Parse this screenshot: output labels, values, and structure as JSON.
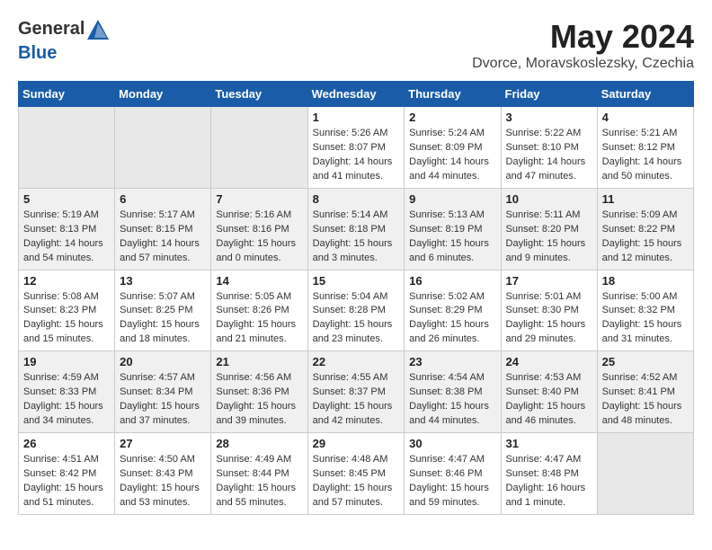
{
  "header": {
    "logo": {
      "general": "General",
      "blue": "Blue",
      "tagline": ""
    },
    "title": "May 2024",
    "location": "Dvorce, Moravskoslezsky, Czechia"
  },
  "calendar": {
    "days_of_week": [
      "Sunday",
      "Monday",
      "Tuesday",
      "Wednesday",
      "Thursday",
      "Friday",
      "Saturday"
    ],
    "weeks": [
      [
        {
          "day": "",
          "info": ""
        },
        {
          "day": "",
          "info": ""
        },
        {
          "day": "",
          "info": ""
        },
        {
          "day": "1",
          "info": "Sunrise: 5:26 AM\nSunset: 8:07 PM\nDaylight: 14 hours\nand 41 minutes."
        },
        {
          "day": "2",
          "info": "Sunrise: 5:24 AM\nSunset: 8:09 PM\nDaylight: 14 hours\nand 44 minutes."
        },
        {
          "day": "3",
          "info": "Sunrise: 5:22 AM\nSunset: 8:10 PM\nDaylight: 14 hours\nand 47 minutes."
        },
        {
          "day": "4",
          "info": "Sunrise: 5:21 AM\nSunset: 8:12 PM\nDaylight: 14 hours\nand 50 minutes."
        }
      ],
      [
        {
          "day": "5",
          "info": "Sunrise: 5:19 AM\nSunset: 8:13 PM\nDaylight: 14 hours\nand 54 minutes."
        },
        {
          "day": "6",
          "info": "Sunrise: 5:17 AM\nSunset: 8:15 PM\nDaylight: 14 hours\nand 57 minutes."
        },
        {
          "day": "7",
          "info": "Sunrise: 5:16 AM\nSunset: 8:16 PM\nDaylight: 15 hours\nand 0 minutes."
        },
        {
          "day": "8",
          "info": "Sunrise: 5:14 AM\nSunset: 8:18 PM\nDaylight: 15 hours\nand 3 minutes."
        },
        {
          "day": "9",
          "info": "Sunrise: 5:13 AM\nSunset: 8:19 PM\nDaylight: 15 hours\nand 6 minutes."
        },
        {
          "day": "10",
          "info": "Sunrise: 5:11 AM\nSunset: 8:20 PM\nDaylight: 15 hours\nand 9 minutes."
        },
        {
          "day": "11",
          "info": "Sunrise: 5:09 AM\nSunset: 8:22 PM\nDaylight: 15 hours\nand 12 minutes."
        }
      ],
      [
        {
          "day": "12",
          "info": "Sunrise: 5:08 AM\nSunset: 8:23 PM\nDaylight: 15 hours\nand 15 minutes."
        },
        {
          "day": "13",
          "info": "Sunrise: 5:07 AM\nSunset: 8:25 PM\nDaylight: 15 hours\nand 18 minutes."
        },
        {
          "day": "14",
          "info": "Sunrise: 5:05 AM\nSunset: 8:26 PM\nDaylight: 15 hours\nand 21 minutes."
        },
        {
          "day": "15",
          "info": "Sunrise: 5:04 AM\nSunset: 8:28 PM\nDaylight: 15 hours\nand 23 minutes."
        },
        {
          "day": "16",
          "info": "Sunrise: 5:02 AM\nSunset: 8:29 PM\nDaylight: 15 hours\nand 26 minutes."
        },
        {
          "day": "17",
          "info": "Sunrise: 5:01 AM\nSunset: 8:30 PM\nDaylight: 15 hours\nand 29 minutes."
        },
        {
          "day": "18",
          "info": "Sunrise: 5:00 AM\nSunset: 8:32 PM\nDaylight: 15 hours\nand 31 minutes."
        }
      ],
      [
        {
          "day": "19",
          "info": "Sunrise: 4:59 AM\nSunset: 8:33 PM\nDaylight: 15 hours\nand 34 minutes."
        },
        {
          "day": "20",
          "info": "Sunrise: 4:57 AM\nSunset: 8:34 PM\nDaylight: 15 hours\nand 37 minutes."
        },
        {
          "day": "21",
          "info": "Sunrise: 4:56 AM\nSunset: 8:36 PM\nDaylight: 15 hours\nand 39 minutes."
        },
        {
          "day": "22",
          "info": "Sunrise: 4:55 AM\nSunset: 8:37 PM\nDaylight: 15 hours\nand 42 minutes."
        },
        {
          "day": "23",
          "info": "Sunrise: 4:54 AM\nSunset: 8:38 PM\nDaylight: 15 hours\nand 44 minutes."
        },
        {
          "day": "24",
          "info": "Sunrise: 4:53 AM\nSunset: 8:40 PM\nDaylight: 15 hours\nand 46 minutes."
        },
        {
          "day": "25",
          "info": "Sunrise: 4:52 AM\nSunset: 8:41 PM\nDaylight: 15 hours\nand 48 minutes."
        }
      ],
      [
        {
          "day": "26",
          "info": "Sunrise: 4:51 AM\nSunset: 8:42 PM\nDaylight: 15 hours\nand 51 minutes."
        },
        {
          "day": "27",
          "info": "Sunrise: 4:50 AM\nSunset: 8:43 PM\nDaylight: 15 hours\nand 53 minutes."
        },
        {
          "day": "28",
          "info": "Sunrise: 4:49 AM\nSunset: 8:44 PM\nDaylight: 15 hours\nand 55 minutes."
        },
        {
          "day": "29",
          "info": "Sunrise: 4:48 AM\nSunset: 8:45 PM\nDaylight: 15 hours\nand 57 minutes."
        },
        {
          "day": "30",
          "info": "Sunrise: 4:47 AM\nSunset: 8:46 PM\nDaylight: 15 hours\nand 59 minutes."
        },
        {
          "day": "31",
          "info": "Sunrise: 4:47 AM\nSunset: 8:48 PM\nDaylight: 16 hours\nand 1 minute."
        },
        {
          "day": "",
          "info": ""
        }
      ]
    ]
  }
}
